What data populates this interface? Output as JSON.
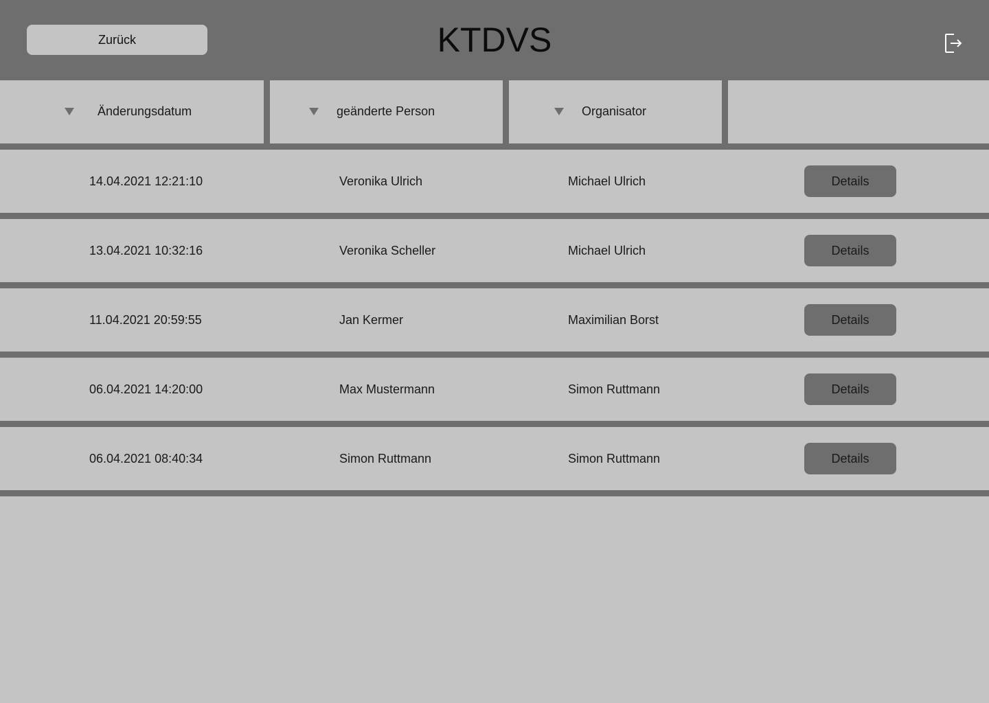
{
  "header": {
    "title": "KTDVS",
    "back_label": "Zurück",
    "logout_icon": "logout-icon"
  },
  "columns": [
    {
      "label": "Änderungsdatum",
      "sort_icon": "sort-down-icon"
    },
    {
      "label": "geänderte Person",
      "sort_icon": "sort-down-icon"
    },
    {
      "label": "Organisator",
      "sort_icon": "sort-down-icon"
    },
    {
      "label": ""
    }
  ],
  "rows": [
    {
      "date": "14.04.2021 12:21:10",
      "person": "Veronika Ulrich",
      "organizer": "Michael Ulrich",
      "action": "Details"
    },
    {
      "date": "13.04.2021 10:32:16",
      "person": "Veronika Scheller",
      "organizer": "Michael Ulrich",
      "action": "Details"
    },
    {
      "date": "11.04.2021 20:59:55",
      "person": "Jan Kermer",
      "organizer": "Maximilian Borst",
      "action": "Details"
    },
    {
      "date": "06.04.2021 14:20:00",
      "person": "Max Mustermann",
      "organizer": "Simon Ruttmann",
      "action": "Details"
    },
    {
      "date": "06.04.2021 08:40:34",
      "person": "Simon Ruttmann",
      "organizer": "Simon Ruttmann",
      "action": "Details"
    }
  ],
  "colors": {
    "header_bg": "#6e6e6e",
    "surface": "#c4c4c4",
    "button_dark": "#6e6e6e"
  }
}
